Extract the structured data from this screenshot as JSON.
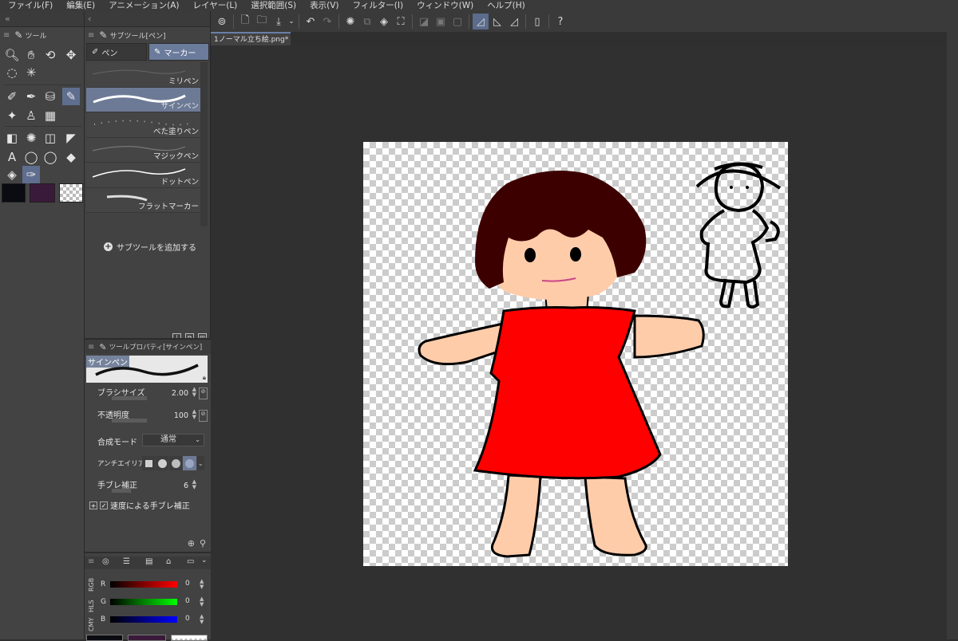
{
  "menu": [
    "ファイル(F)",
    "編集(E)",
    "アニメーション(A)",
    "レイヤー(L)",
    "選択範囲(S)",
    "表示(V)",
    "フィルター(I)",
    "ウィンドウ(W)",
    "ヘルプ(H)"
  ],
  "tool_panel": {
    "tab_label": "ツール",
    "icons": [
      "zoom-icon",
      "hand-icon",
      "rotate-icon",
      "move-icon",
      "lasso-icon",
      "magic-wand-icon",
      "pen-icon",
      "eyedropper-icon",
      "airbrush-icon",
      "marker-icon",
      "sparkle-icon",
      "stamp-icon",
      "grid-icon",
      "gradient-icon",
      "burst-icon",
      "frame-icon",
      "ruler-icon",
      "text-icon",
      "speech-bubble-icon",
      "balloon-icon",
      "eraser-icon",
      "fill-icon",
      "color-picker-icon"
    ]
  },
  "colors": {
    "main": "#0b0b12",
    "sub": "#3a1a3a",
    "accent": "#6b7b9c"
  },
  "subtool": {
    "tab_label": "サブツール[ペン]",
    "tabs": [
      "ペン",
      "マーカー"
    ],
    "brushes": [
      "ミリペン",
      "サインペン",
      "べた塗りペン",
      "マジックペン",
      "ドットペン",
      "フラットマーカー"
    ],
    "selected_brush": "サインペン",
    "add_label": "サブツールを追加する"
  },
  "tool_property": {
    "header": "ツールプロパティ[サインペン]",
    "preview_label": "サインペン",
    "brush_size_label": "ブラシサイズ",
    "brush_size": "2.00",
    "opacity_label": "不透明度",
    "opacity": "100",
    "blend_label": "合成モード",
    "blend_value": "通常",
    "aa_label": "アンチエイリアス",
    "stabilize_label": "手ブレ補正",
    "stabilize_value": "6",
    "speed_label": "速度による手ブレ補正"
  },
  "color_panel": {
    "channels": [
      {
        "name": "R",
        "value": "0"
      },
      {
        "name": "G",
        "value": "0"
      },
      {
        "name": "B",
        "value": "0"
      }
    ],
    "modes": [
      "RGB",
      "HLS",
      "CMY"
    ]
  },
  "document": {
    "tab_label": "1ノーマル立ち絵.png*"
  }
}
